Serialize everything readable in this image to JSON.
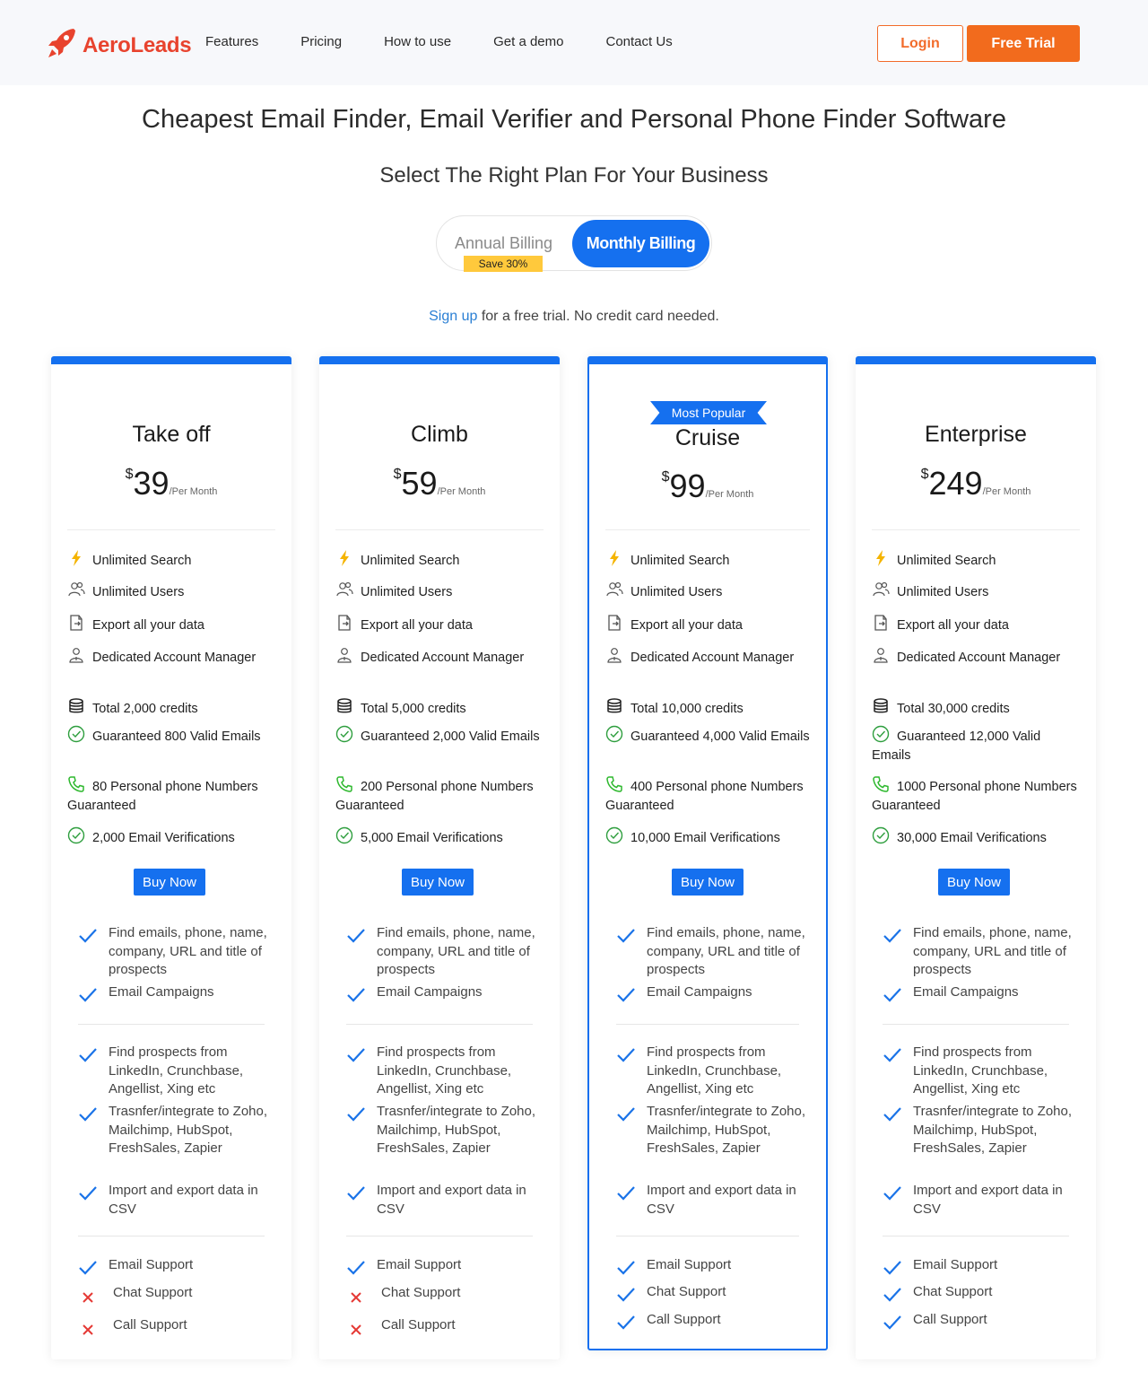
{
  "header": {
    "brand": "AeroLeads",
    "nav": [
      "Features",
      "Pricing",
      "How to use",
      "Get a demo",
      "Contact Us"
    ],
    "login_label": "Login",
    "trial_label": "Free Trial"
  },
  "main_title": "Cheapest Email Finder, Email Verifier and Personal Phone Finder Software",
  "sub_title": "Select The Right Plan For Your Business",
  "billing": {
    "annual_label": "Annual Billing",
    "save_label": "Save 30%",
    "monthly_label": "Monthly Billing"
  },
  "signup": {
    "link_text": "Sign up",
    "rest_text": " for a free trial. No credit card needed."
  },
  "currency": "$",
  "per_label": "/Per Month",
  "buy_label": "Buy Now",
  "popular_label": "Most Popular",
  "plans": [
    {
      "name": "Take off",
      "price": "39",
      "features": [
        "Unlimited Search",
        "Unlimited Users",
        "Export all your data",
        "Dedicated Account Manager",
        "Total 2,000 credits",
        "Guaranteed 800 Valid Emails",
        "80 Personal phone Numbers Guaranteed",
        "2,000 Email Verifications"
      ],
      "support": [
        {
          "label": "Email Support",
          "included": true
        },
        {
          "label": "Chat Support",
          "included": false
        },
        {
          "label": "Call Support",
          "included": false
        }
      ]
    },
    {
      "name": "Climb",
      "price": "59",
      "features": [
        "Unlimited Search",
        "Unlimited Users",
        "Export all your data",
        "Dedicated Account Manager",
        "Total 5,000 credits",
        "Guaranteed 2,000 Valid Emails",
        "200 Personal phone Numbers Guaranteed",
        "5,000 Email Verifications"
      ],
      "support": [
        {
          "label": "Email Support",
          "included": true
        },
        {
          "label": "Chat Support",
          "included": false
        },
        {
          "label": "Call Support",
          "included": false
        }
      ]
    },
    {
      "name": "Cruise",
      "price": "99",
      "features": [
        "Unlimited Search",
        "Unlimited Users",
        "Export all your data",
        "Dedicated Account Manager",
        "Total 10,000 credits",
        "Guaranteed 4,000 Valid Emails",
        "400 Personal phone Numbers Guaranteed",
        "10,000 Email Verifications"
      ],
      "support": [
        {
          "label": "Email Support",
          "included": true
        },
        {
          "label": "Chat Support",
          "included": true
        },
        {
          "label": "Call Support",
          "included": true
        }
      ]
    },
    {
      "name": "Enterprise",
      "price": "249",
      "features": [
        "Unlimited Search",
        "Unlimited Users",
        "Export all your data",
        "Dedicated Account Manager",
        "Total 30,000 credits",
        "Guaranteed 12,000 Valid Emails",
        "1000 Personal phone Numbers Guaranteed",
        "30,000 Email Verifications"
      ],
      "support": [
        {
          "label": "Email Support",
          "included": true
        },
        {
          "label": "Chat Support",
          "included": true
        },
        {
          "label": "Call Support",
          "included": true
        }
      ]
    }
  ],
  "common_features": {
    "group1": [
      "Find emails, phone, name, company, URL and title of prospects",
      "Email Campaigns"
    ],
    "group2": [
      "Find prospects from LinkedIn, Crunchbase, Angellist, Xing etc",
      "Trasnfer/integrate to Zoho, Mailchimp, HubSpot, FreshSales, Zapier",
      "Import and export data in CSV"
    ]
  },
  "colors": {
    "brand": "#e8432e",
    "accent_orange": "#f26b1d",
    "primary_blue": "#1570ef",
    "badge_yellow": "#ffc93c",
    "check_blue": "#1a73e8",
    "cross_red": "#e53935",
    "phone_green": "#2eb82e"
  },
  "icons": {
    "feature_icons": [
      "lightning-icon",
      "users-icon",
      "export-icon",
      "account-manager-icon",
      "database-icon",
      "check-circle-icon",
      "phone-icon",
      "check-circle-icon"
    ],
    "included": "check-icon",
    "excluded": "cross-icon"
  }
}
